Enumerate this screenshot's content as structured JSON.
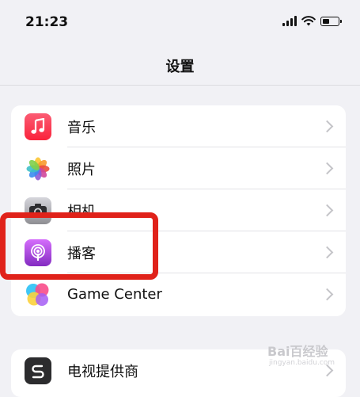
{
  "status_bar": {
    "time": "21:23",
    "icons": [
      "signal-icon",
      "wifi-icon",
      "battery-icon"
    ]
  },
  "nav": {
    "title": "设置"
  },
  "groups": [
    {
      "items": [
        {
          "label": "音乐",
          "icon": "music-icon"
        },
        {
          "label": "照片",
          "icon": "photos-icon"
        },
        {
          "label": "相机",
          "icon": "camera-icon"
        },
        {
          "label": "播客",
          "icon": "podcasts-icon"
        },
        {
          "label": "Game Center",
          "icon": "game-center-icon"
        }
      ]
    },
    {
      "items": [
        {
          "label": "电视提供商",
          "icon": "tv-provider-icon"
        }
      ]
    }
  ],
  "annotation": {
    "highlighted_item": "播客",
    "color": "#e0221a"
  },
  "watermark": {
    "text": "Bai百经验",
    "sub": "jingyan.baidu.com"
  },
  "colors": {
    "background": "#f1f1f5",
    "chevron": "#c4c4c8",
    "music": "#fa233b",
    "podcasts": "#832bc1"
  }
}
